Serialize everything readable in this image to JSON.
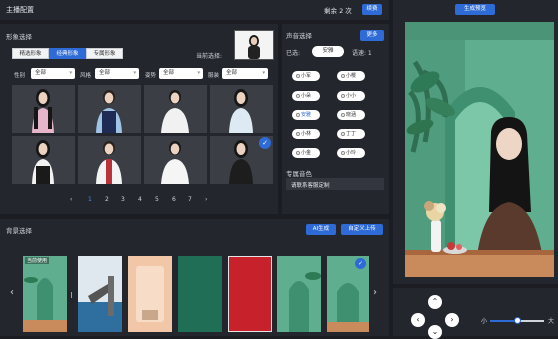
{
  "header": {
    "title": "主播配置",
    "remaining": "剩余 2 次",
    "renew_label": "续费"
  },
  "image_select": {
    "title": "形象选择",
    "tabs": [
      {
        "label": "精选形象"
      },
      {
        "label": "经典形象"
      },
      {
        "label": "专属形象"
      }
    ],
    "current_label": "当前选择:",
    "filters": [
      {
        "label": "性别",
        "value": "全部"
      },
      {
        "label": "风格",
        "value": "全部"
      },
      {
        "label": "姿势",
        "value": "全部"
      },
      {
        "label": "服装",
        "value": "全部"
      }
    ],
    "pages": [
      "1",
      "2",
      "3",
      "4",
      "5",
      "6",
      "7"
    ],
    "current_page": "1"
  },
  "voice": {
    "title": "声音选择",
    "more_label": "更多",
    "selected_label": "已选:",
    "selected_value": "安雅",
    "speed_label": "语速: 1",
    "options": [
      {
        "label": "小军"
      },
      {
        "label": "小樱"
      },
      {
        "label": "小朵"
      },
      {
        "label": "小小"
      },
      {
        "label": "安雅"
      },
      {
        "label": "晓涵"
      },
      {
        "label": "小林"
      },
      {
        "label": "丁丁"
      },
      {
        "label": "小金"
      },
      {
        "label": "小玲"
      }
    ],
    "custom_title": "专属音色",
    "custom_contact": "请联系客服定制"
  },
  "preview": {
    "generate_label": "生成预览"
  },
  "background": {
    "title": "背景选择",
    "ai_label": "AI生成",
    "upload_label": "自定义上传",
    "current_tag": "当前使用"
  },
  "controls": {
    "size_small": "小",
    "size_large": "大",
    "size_value": 0.5
  },
  "colors": {
    "accent": "#2e6bd6",
    "panel": "#23262d",
    "background": "#1b1d23"
  }
}
